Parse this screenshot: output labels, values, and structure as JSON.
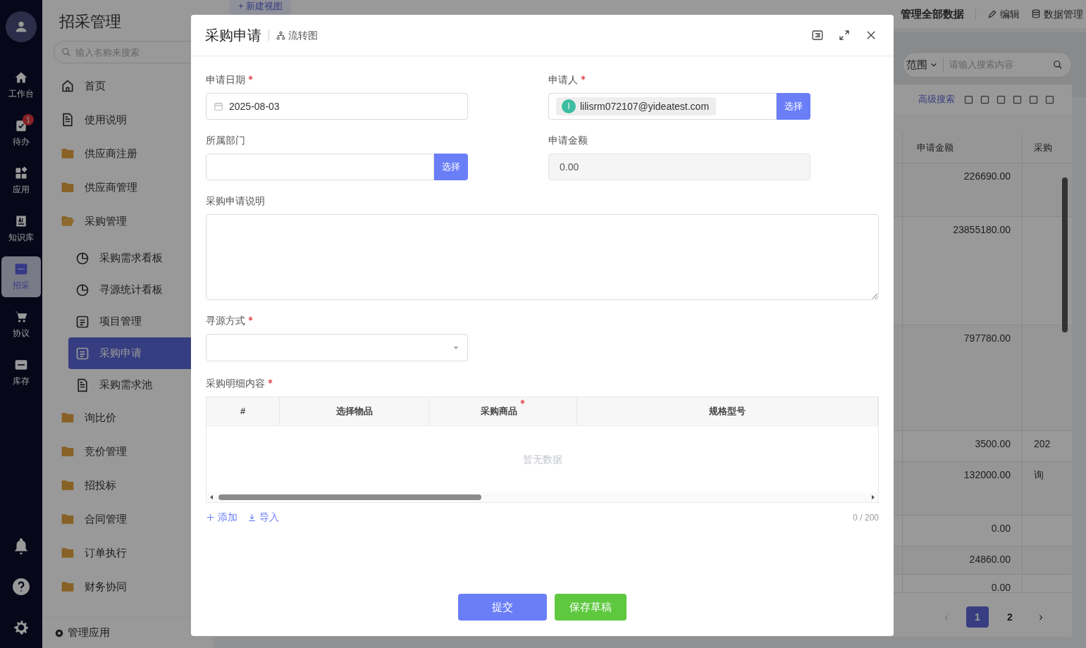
{
  "rail": {
    "items": [
      {
        "label": "工作台",
        "selected": false
      },
      {
        "label": "待办",
        "selected": false,
        "badge": "1"
      },
      {
        "label": "应用",
        "selected": false
      },
      {
        "label": "知识库",
        "selected": false
      },
      {
        "label": "招采",
        "selected": true
      },
      {
        "label": "协议",
        "selected": false
      },
      {
        "label": "库存",
        "selected": false
      }
    ]
  },
  "sidebar": {
    "title": "招采管理",
    "search": {
      "placeholder": "输入名称来搜索"
    },
    "items": [
      {
        "label": "首页",
        "kind": "home",
        "selected": false
      },
      {
        "label": "使用说明",
        "kind": "doc",
        "selected": false
      },
      {
        "label": "供应商注册",
        "kind": "folder",
        "selected": false
      },
      {
        "label": "供应商管理",
        "kind": "folder",
        "selected": false
      },
      {
        "label": "采购管理",
        "kind": "folder-open",
        "selected": false,
        "children": [
          {
            "label": "采购需求看板",
            "kind": "chart",
            "selected": false
          },
          {
            "label": "寻源统计看板",
            "kind": "chart",
            "selected": false
          },
          {
            "label": "项目管理",
            "kind": "form",
            "selected": false
          },
          {
            "label": "采购申请",
            "kind": "form",
            "selected": true
          },
          {
            "label": "采购需求池",
            "kind": "doc",
            "selected": false
          }
        ]
      },
      {
        "label": "询比价",
        "kind": "folder",
        "selected": false
      },
      {
        "label": "竞价管理",
        "kind": "folder",
        "selected": false
      },
      {
        "label": "招投标",
        "kind": "folder",
        "selected": false
      },
      {
        "label": "合同管理",
        "kind": "folder",
        "selected": false
      },
      {
        "label": "订单执行",
        "kind": "folder",
        "selected": false
      },
      {
        "label": "财务协同",
        "kind": "folder",
        "selected": false
      }
    ],
    "footer": "管理应用"
  },
  "main": {
    "new_view": "+ 新建视图",
    "header_title": "管理全部数据",
    "header_actions": [
      "编辑",
      "数据管理"
    ],
    "scope": "范围",
    "search": {
      "placeholder": "请输入搜索内容"
    },
    "advanced_search": "高级搜索",
    "columns": [
      "申请金额",
      "采购"
    ],
    "rows": [
      {
        "amount": "226690.00",
        "column_3": ""
      },
      {
        "amount": "23855180.00",
        "column_3": ""
      },
      {
        "amount": "797780.00",
        "column_3": ""
      },
      {
        "amount": "3500.00",
        "column_3": "202"
      },
      {
        "amount": "132000.00",
        "column_3": "询"
      },
      {
        "amount": "0.00",
        "column_3": ""
      },
      {
        "amount": "24860.00",
        "column_3": ""
      },
      {
        "amount": "0.00",
        "column_3": ""
      }
    ],
    "pagination": [
      {
        "label": "1",
        "selected": true
      },
      {
        "label": "2",
        "selected": false
      }
    ],
    "prev": "‹",
    "next": "›"
  },
  "dialog": {
    "title": "采购申请",
    "flow_link": "流转图",
    "fields": [
      {
        "label": "申请日期",
        "required": true,
        "kind": "date",
        "value": "2025-08-03"
      },
      {
        "label": "申请人",
        "required": true,
        "kind": "user",
        "avatar": "l",
        "value": "lilisrm072107@yideatest.com",
        "button": "选择"
      },
      {
        "label": "所属部门",
        "required": false,
        "kind": "picker",
        "button": "选择"
      },
      {
        "label": "申请金额",
        "required": false,
        "kind": "readonly",
        "value": "0.00"
      },
      {
        "label": "采购申请说明",
        "required": false,
        "kind": "textarea"
      },
      {
        "label": "寻源方式",
        "required": true,
        "kind": "select"
      }
    ],
    "details": {
      "label": "采购明细内容",
      "required": true,
      "columns": [
        {
          "label": "#",
          "required": false
        },
        {
          "label": "选择物品",
          "required": false
        },
        {
          "label": "采购商品",
          "required": true
        },
        {
          "label": "规格型号",
          "required": false
        }
      ],
      "empty": "暂无数据",
      "actions": [
        "添加",
        "导入"
      ],
      "counter": "0 / 200"
    },
    "buttons": [
      {
        "label": "提交",
        "kind": "primary"
      },
      {
        "label": "保存草稿",
        "kind": "success"
      }
    ]
  }
}
